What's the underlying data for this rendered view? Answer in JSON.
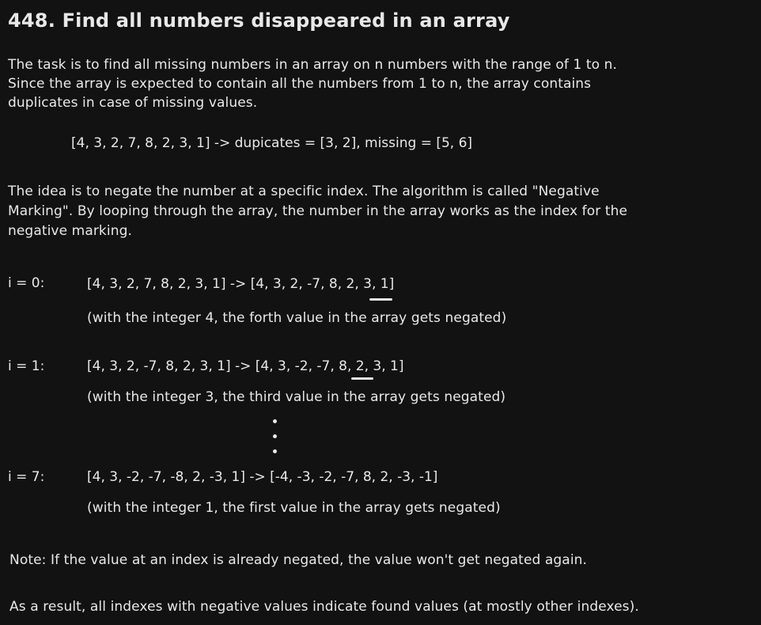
{
  "title": "448. Find all numbers disappeared in an array",
  "intro": [
    "The task is to find all missing numbers in an array on n numbers with the range of 1 to n.",
    "Since the array is expected to contain all the numbers from 1 to n, the array contains",
    "duplicates in case of missing values."
  ],
  "example": "[4, 3, 2, 7, 8, 2, 3, 1] -> dupicates = [3, 2], missing = [5, 6]",
  "idea": [
    "The idea is to negate the number at a specific index. The algorithm is called \"Negative",
    "Marking\". By looping through the array, the number in the array works as the index for the",
    "negative marking."
  ],
  "steps": [
    {
      "label": "i = 0:",
      "expression": "[4, 3, 2, 7, 8, 2, 3, 1] -> [4, 3, 2, -7, 8, 2, 3, 1]",
      "note": "(with the integer 4, the forth value in the array gets negated)"
    },
    {
      "label": "i = 1:",
      "expression": "[4, 3, 2, -7, 8, 2, 3, 1] -> [4, 3, -2, -7, 8, 2, 3, 1]",
      "note": "(with the integer 3, the third value in the array gets negated)"
    },
    {
      "label": "i = 7:",
      "expression": "[4, 3, -2, -7, -8, 2, -3, 1] -> [-4, -3, -2, -7, 8, 2, -3, -1]",
      "note": "(with the integer 1, the first value in the array gets negated)"
    }
  ],
  "note_line": "Note: If the value at an index is already negated, the value won't get negated again.",
  "result_line": "As a result, all indexes with negative values indicate found values (at mostly other indexes)."
}
